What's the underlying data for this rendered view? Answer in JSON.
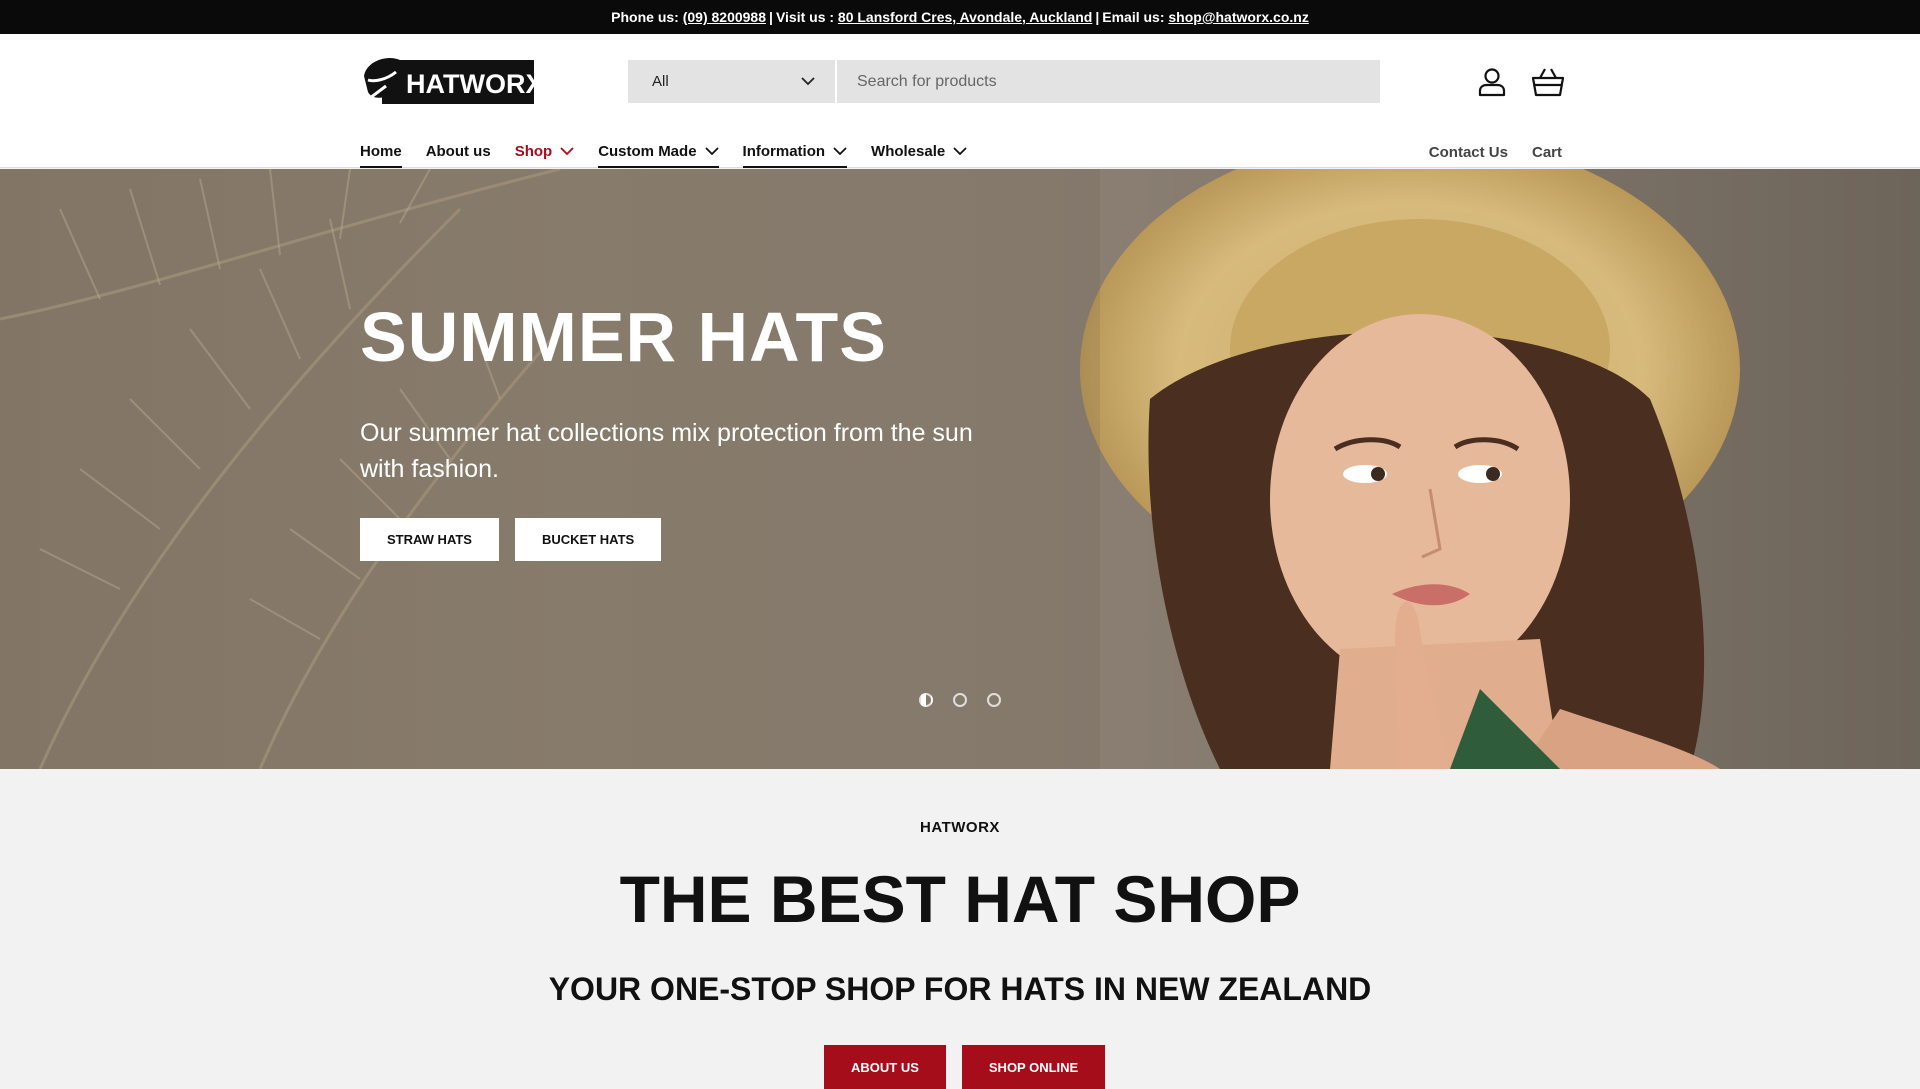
{
  "announcement": {
    "phone_label": "Phone us:",
    "phone": "(09) 8200988",
    "visit_label": "Visit us :",
    "address": "80 Lansford Cres, Avondale, Auckland",
    "email_label": "Email us:",
    "email": "shop@hatworx.co.nz",
    "separator": "|"
  },
  "header": {
    "logo_text": "HATWORX",
    "search": {
      "category_selected": "All",
      "placeholder": "Search for products"
    },
    "icons": {
      "account": "account-icon",
      "cart": "cart-icon"
    }
  },
  "nav": {
    "items": [
      {
        "label": "Home"
      },
      {
        "label": "About us"
      },
      {
        "label": "Shop"
      },
      {
        "label": "Custom Made"
      },
      {
        "label": "Information"
      },
      {
        "label": "Wholesale"
      }
    ],
    "right": [
      {
        "label": "Contact Us"
      },
      {
        "label": "Cart"
      }
    ]
  },
  "hero": {
    "title": "SUMMER HATS",
    "subtitle": "Our summer hat collections mix protection from the sun with fashion.",
    "buttons": [
      {
        "label": "STRAW HATS"
      },
      {
        "label": "BUCKET HATS"
      }
    ],
    "slides_total": 3,
    "slide_active": 1
  },
  "intro": {
    "eyebrow": "HATWORX",
    "title": "THE BEST HAT SHOP",
    "subtitle": "YOUR ONE-STOP SHOP FOR HATS IN NEW ZEALAND",
    "buttons": [
      {
        "label": "ABOUT US"
      },
      {
        "label": "SHOP ONLINE"
      }
    ]
  },
  "colors": {
    "brand_red": "#a50d1a",
    "topbar_bg": "#0a0a0a",
    "search_bg": "#e3e3e3"
  }
}
